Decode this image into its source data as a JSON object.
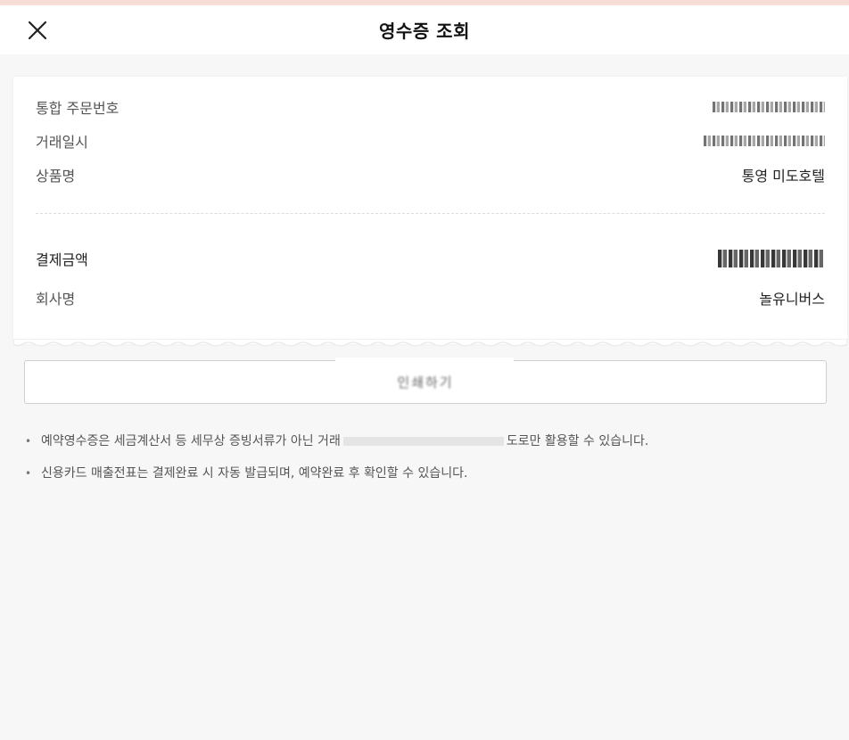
{
  "header": {
    "title": "영수증 조회",
    "close_icon": "close-icon"
  },
  "receipt": {
    "order_label": "통합 주문번호",
    "datetime_label": "거래일시",
    "product_label": "상품명",
    "product_value": "통영 미도호텔",
    "amount_label": "결제금액",
    "company_label": "회사명",
    "company_value": "놀유니버스"
  },
  "actions": {
    "print_label": "인쇄하기"
  },
  "notes": [
    "예약영수증은 세금계산서 등 세무상 증빙서류가 아닌 거래",
    "도로만 활용할 수 있습니다.",
    "신용카드 매출전표는 결제완료 시 자동 발급되며, 예약완료 후 확인할 수 있습니다."
  ]
}
